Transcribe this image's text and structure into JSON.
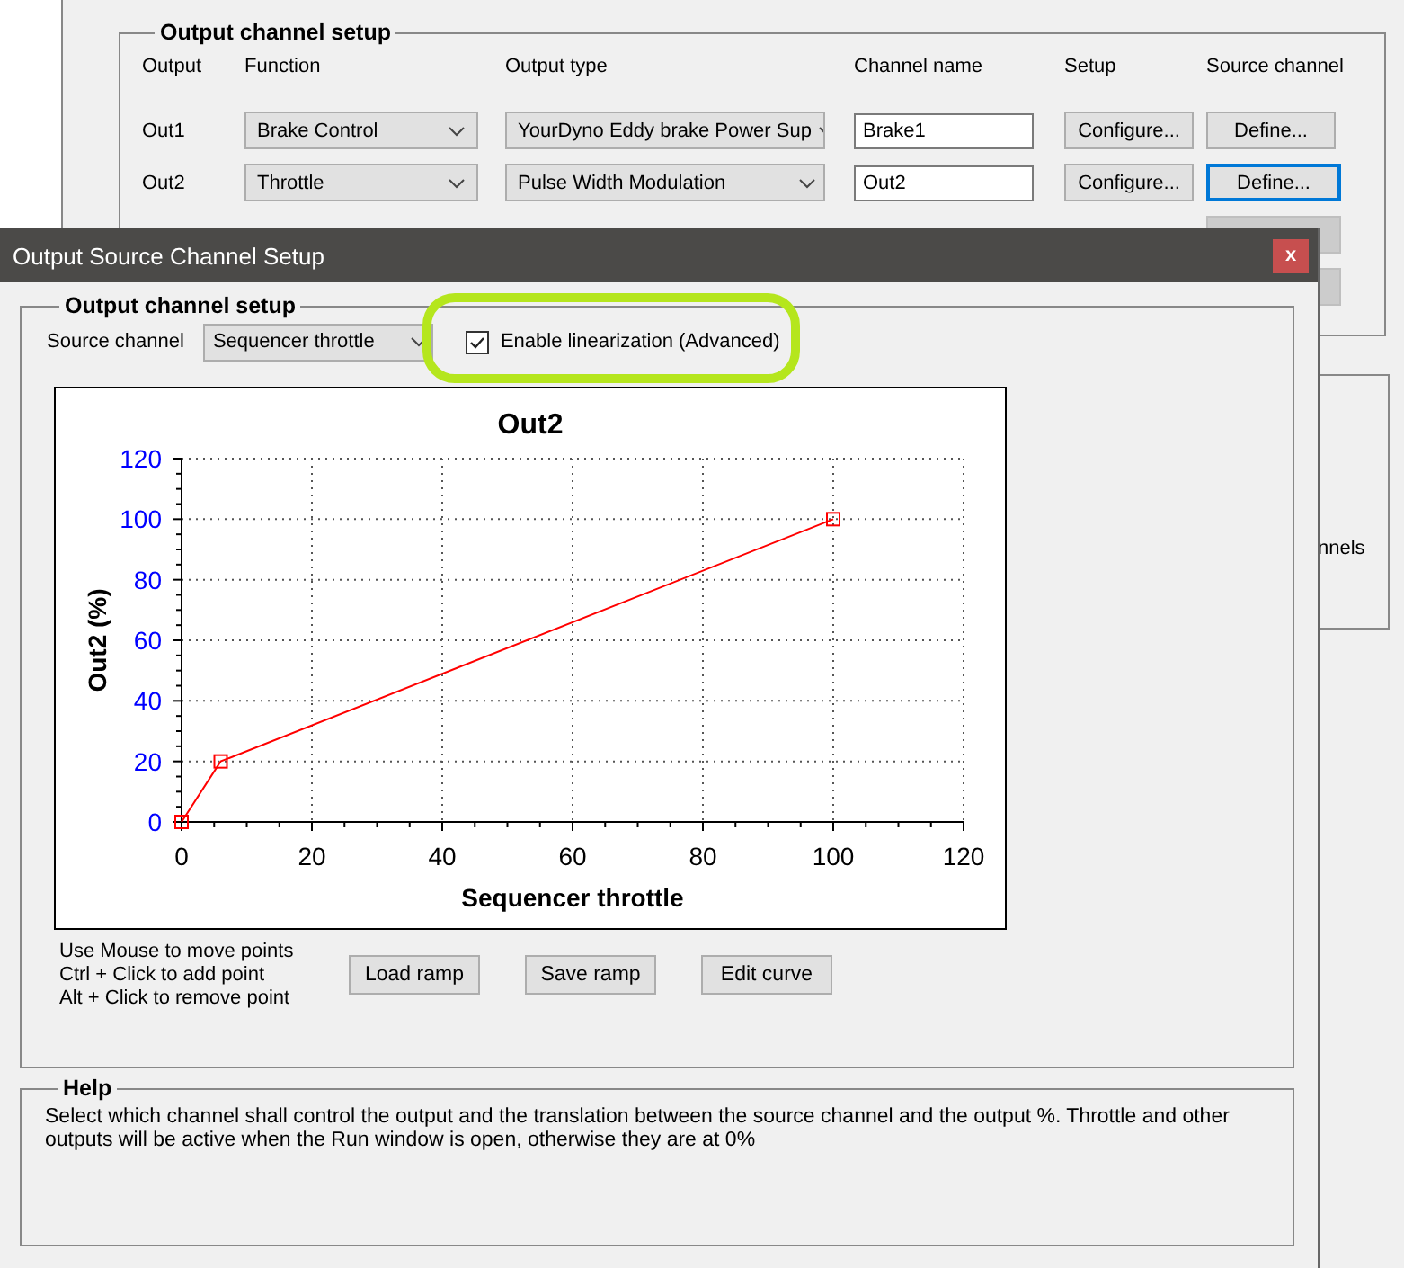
{
  "background_window": {
    "group_title": "Output channel setup",
    "columns": [
      "Output",
      "Function",
      "Output type",
      "Channel name",
      "Setup",
      "Source channel"
    ],
    "rows": [
      {
        "output": "Out1",
        "function": "Brake Control",
        "output_type": "YourDyno Eddy brake Power Sup",
        "channel_name": "Brake1",
        "setup": "Configure...",
        "source": "Define...",
        "focused": false
      },
      {
        "output": "Out2",
        "function": "Throttle",
        "output_type": "Pulse Width Modulation",
        "channel_name": "Out2",
        "setup": "Configure...",
        "source": "Define...",
        "focused": true
      }
    ],
    "side_group_text": "nnels"
  },
  "dialog": {
    "title": "Output Source Channel Setup",
    "close": "x",
    "group_title": "Output channel setup",
    "source_label": "Source channel",
    "source_value": "Sequencer throttle",
    "linearization": {
      "label": "Enable linearization (Advanced)",
      "checked": true,
      "highlighted": true
    },
    "chart_data": {
      "type": "line",
      "title": "Out2",
      "xlabel": "Sequencer throttle",
      "ylabel": "Out2 (%)",
      "x": [
        0,
        6,
        100
      ],
      "series": [
        {
          "color": "#ff0000",
          "marker": "square",
          "values": [
            0,
            20,
            100
          ]
        }
      ],
      "grid": true,
      "xlim": [
        0,
        120
      ],
      "ylim": [
        0,
        120
      ],
      "xticks": [
        0,
        20,
        40,
        60,
        80,
        100,
        120
      ],
      "yticks": [
        0,
        20,
        40,
        60,
        80,
        100,
        120
      ]
    },
    "hints": [
      "Use Mouse to move points",
      "Ctrl + Click to add point",
      "Alt + Click to remove point"
    ],
    "buttons": [
      "Load ramp",
      "Save ramp",
      "Edit curve"
    ],
    "help_title": "Help",
    "help_text": "Select which channel shall control the output and the translation between the source channel and the output %. Throttle and other outputs will be active when the Run window is open, otherwise they are at 0%"
  }
}
